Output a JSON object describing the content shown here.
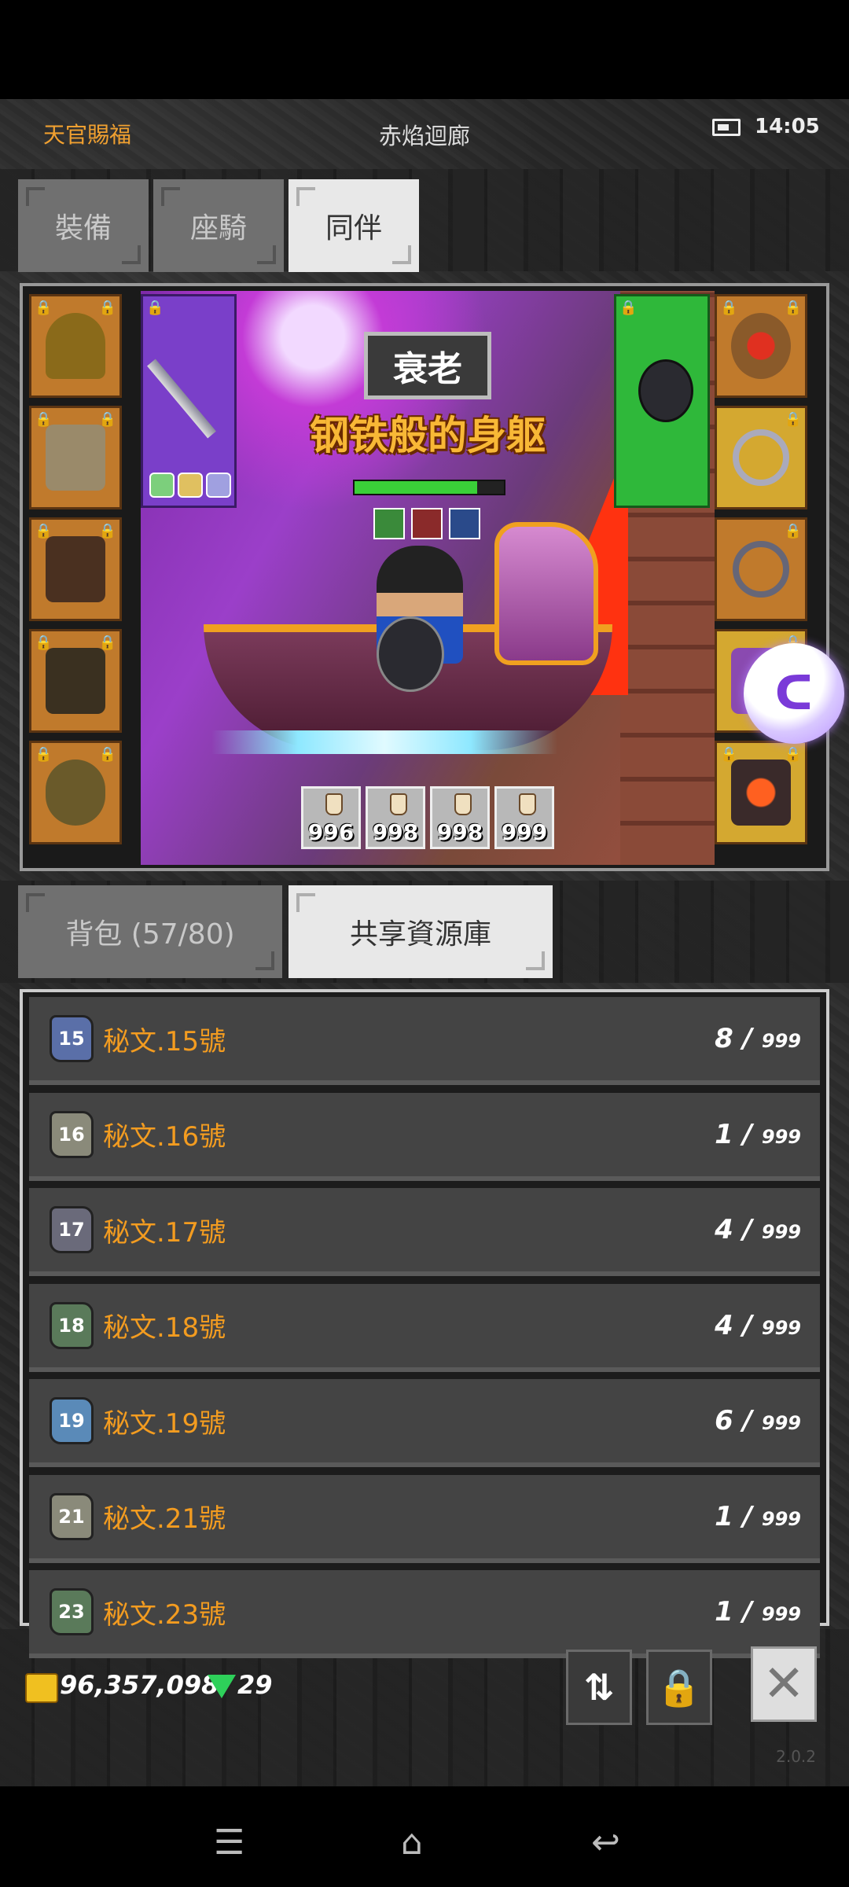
{
  "header": {
    "event_title": "天官賜福",
    "location": "赤焰迴廊",
    "time": "14:05"
  },
  "top_tabs": [
    {
      "label": "裝備",
      "active": false
    },
    {
      "label": "座騎",
      "active": false
    },
    {
      "label": "同伴",
      "active": true
    }
  ],
  "scene": {
    "debuff": "衰老",
    "buff_name": "钢铁般的身躯",
    "hp_fraction": 0.82,
    "potions": [
      "996",
      "998",
      "998",
      "999"
    ]
  },
  "bottom_tabs": [
    {
      "label": "背包 (57/80)",
      "active": false
    },
    {
      "label": "共享資源庫",
      "active": true
    }
  ],
  "resources": [
    {
      "icon_number": "15",
      "name": "秘文.15號",
      "count": "8",
      "max": "999",
      "color": "#5a6fa8"
    },
    {
      "icon_number": "16",
      "name": "秘文.16號",
      "count": "1",
      "max": "999",
      "color": "#8a8a7a"
    },
    {
      "icon_number": "17",
      "name": "秘文.17號",
      "count": "4",
      "max": "999",
      "color": "#6a6a7a"
    },
    {
      "icon_number": "18",
      "name": "秘文.18號",
      "count": "4",
      "max": "999",
      "color": "#5a7a5a"
    },
    {
      "icon_number": "19",
      "name": "秘文.19號",
      "count": "6",
      "max": "999",
      "color": "#5a8ab8"
    },
    {
      "icon_number": "21",
      "name": "秘文.21號",
      "count": "1",
      "max": "999",
      "color": "#8a8a7a"
    },
    {
      "icon_number": "23",
      "name": "秘文.23號",
      "count": "1",
      "max": "999",
      "color": "#5a7a5a"
    }
  ],
  "footer": {
    "gold": "96,357,098",
    "gems": "29",
    "version": "2.0.2"
  },
  "icons": {
    "battery": "battery-icon",
    "gold": "gold-coins-icon",
    "gem": "green-gem-icon",
    "sort": "sort-arrows-icon",
    "lock": "lock-icon",
    "close": "close-icon",
    "float": "assistant-bubble-icon"
  }
}
